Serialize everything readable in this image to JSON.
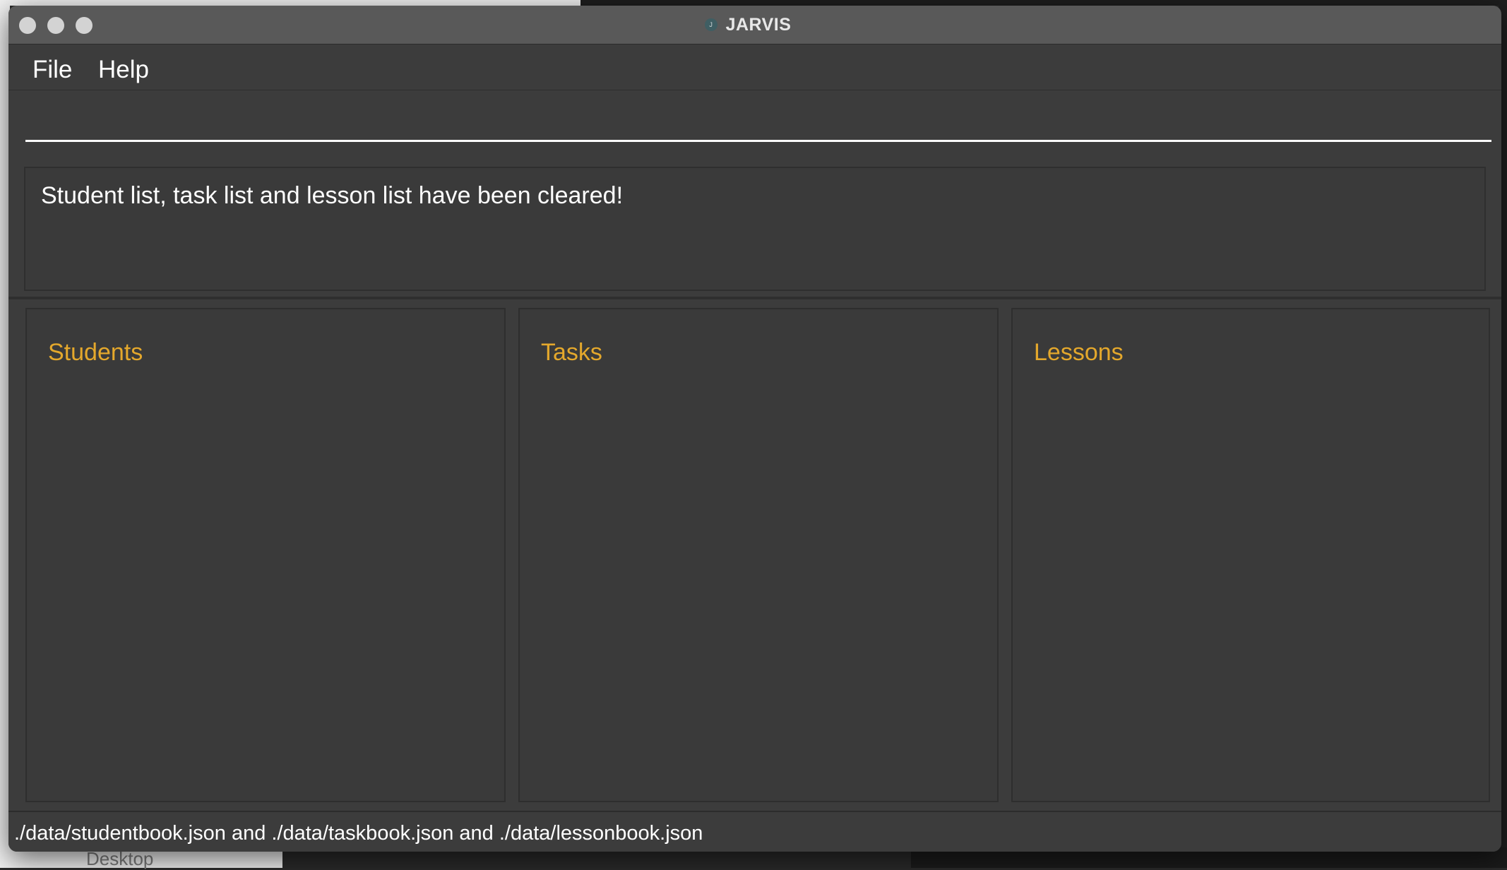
{
  "window": {
    "title": "JARVIS",
    "app_icon_glyph": "J"
  },
  "menu": {
    "file_label": "File",
    "help_label": "Help"
  },
  "command_box": {
    "value": "",
    "placeholder": ""
  },
  "result_display": {
    "message": "Student list, task list and lesson list have been cleared!"
  },
  "panels": {
    "students_title": "Students",
    "tasks_title": "Tasks",
    "lessons_title": "Lessons"
  },
  "status_bar": {
    "text": "./data/studentbook.json and ./data/taskbook.json and ./data/lessonbook.json"
  },
  "background": {
    "dock_label": "Desktop"
  },
  "colors": {
    "panel_title": "#e4a82c",
    "window_bg": "#3c3c3c",
    "titlebar_bg": "#595959"
  }
}
